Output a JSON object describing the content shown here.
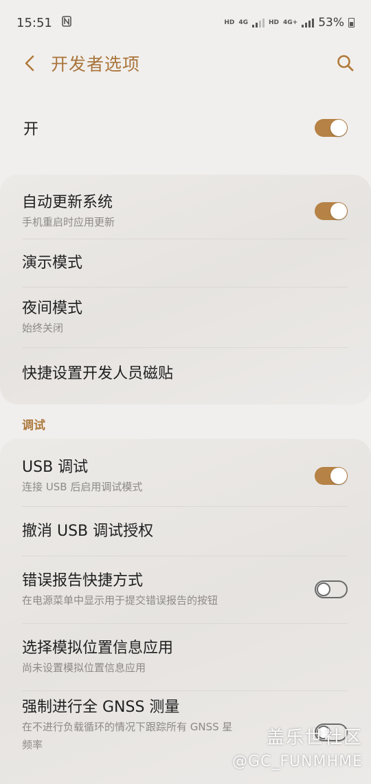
{
  "status_bar": {
    "time": "15:51",
    "nfc_icon": "nfc-icon",
    "hd1": "HD",
    "net1": "4G",
    "hd2": "HD",
    "net2": "4G+",
    "battery": "53%"
  },
  "app_bar": {
    "title": "开发者选项",
    "back_icon": "chevron-left-icon",
    "search_icon": "search-icon",
    "accent_color": "#a9743b"
  },
  "master": {
    "label": "开",
    "toggle_on": true
  },
  "group1": {
    "auto_update": {
      "title": "自动更新系统",
      "subtitle": "手机重启时应用更新",
      "toggle_on": true
    },
    "demo_mode": {
      "title": "演示模式"
    },
    "night_mode": {
      "title": "夜间模式",
      "subtitle": "始终关闭"
    },
    "quick_tiles": {
      "title": "快捷设置开发人员磁贴"
    }
  },
  "debug_section": {
    "header": "调试"
  },
  "group2": {
    "usb_debug": {
      "title": "USB 调试",
      "subtitle": "连接 USB 后启用调试模式",
      "toggle_on": true
    },
    "revoke_usb": {
      "title": "撤消 USB 调试授权"
    },
    "bug_report": {
      "title": "错误报告快捷方式",
      "subtitle": "在电源菜单中显示用于提交错误报告的按钮",
      "toggle_on": false
    },
    "mock_location": {
      "title": "选择模拟位置信息应用",
      "subtitle": "尚未设置模拟位置信息应用"
    },
    "gnss": {
      "title": "强制进行全 GNSS 测量",
      "subtitle": "在不进行负载循环的情况下跟踪所有 GNSS 星",
      "subtitle2": "频率",
      "toggle_on": false
    }
  },
  "watermark": {
    "line1": "盖乐世社区",
    "line2": "@GC_FUNMHME"
  }
}
